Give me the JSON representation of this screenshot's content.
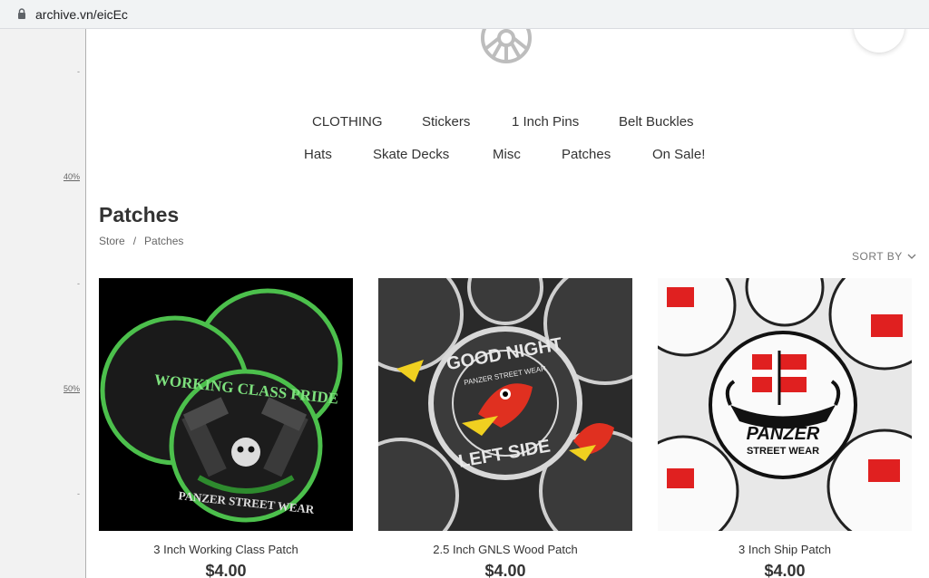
{
  "browser": {
    "url": "archive.vn/eicEc"
  },
  "sidebar": {
    "labels": [
      "40%",
      "50%"
    ]
  },
  "nav": {
    "row1": [
      "CLOTHING",
      "Stickers",
      "1 Inch Pins",
      "Belt Buckles"
    ],
    "row2": [
      "Hats",
      "Skate Decks",
      "Misc",
      "Patches",
      "On Sale!"
    ]
  },
  "page": {
    "title": "Patches",
    "breadcrumb": [
      "Store",
      "/",
      "Patches"
    ],
    "sort_label": "SORT BY"
  },
  "products": [
    {
      "name": "3 Inch Working Class Patch",
      "price": "$4.00",
      "image_text": [
        "WORKING CLASS PRIDE",
        "PANZER STREET WEAR"
      ]
    },
    {
      "name": "2.5 Inch GNLS Wood Patch",
      "price": "$4.00",
      "image_text": [
        "GOOD NIGHT",
        "LEFT SIDE",
        "PANZER STREET WEAR"
      ]
    },
    {
      "name": "3 Inch Ship Patch",
      "price": "$4.00",
      "image_text": [
        "PANZER",
        "STREET WEAR"
      ]
    }
  ],
  "colors": {
    "text": "#333333",
    "patch_green": "#4cc04c",
    "patch_red": "#e02020"
  }
}
